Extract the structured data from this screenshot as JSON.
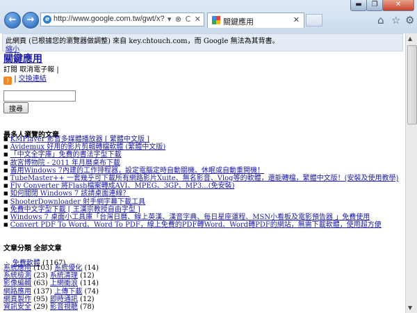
{
  "browser": {
    "url": "http://www.google.com.tw/gwt/x?u=",
    "addr_tools": "▾ ⊗ C ✕",
    "tab_title": "關鍵應用",
    "tab_close": "✕",
    "back_glyph": "←",
    "forward_glyph": "→",
    "home_glyph": "⌂",
    "star_glyph": "☆",
    "gear_glyph": "⚙",
    "min_glyph": "▬",
    "max_glyph": "❐",
    "close_glyph": "✕",
    "colors": {
      "chrome": "#cbdcef",
      "accent": "#1f5fb5",
      "close": "#c7432b"
    }
  },
  "notice": {
    "text": "此網頁 (已根據您的瀏覽器做調整) 來自 key.chtouch.com，而 Google 無法為其背書。",
    "link": "縮小"
  },
  "page": {
    "title": "關鍵應用",
    "subscribe": "訂閱",
    "unsubscribe": "取消電子報",
    "separator": "|",
    "rss_glyph": ")",
    "exchange_link": "交換連結",
    "search_value": "",
    "search_button": "搜尋"
  },
  "popular": {
    "heading": "最多人瀏覽的文章",
    "items": [
      "KMPlayer 影音多媒體播放器 [ 繁體中文版 ]",
      "Avidemux 好用的影片剪輯轉檔軟體 (繁體中文版)",
      "「中文全字庫」免費的書法字型下載",
      "故宮博物院 - 2011 年月曆桌布下載",
      "善用Windows 7內建的工作排程器，設定電腦定時自動關機、休眠或自動重開機！",
      "TubeMaster++ 一套幾乎可下載所有網路影片Xuite、無名影音、Vlog等的軟體，還能轉檔，繁體中文版！(安裝及使用教學)",
      "Fly Converter 將Flash檔案轉成AVI、MPEG、3GP、MP3...(免安裝)",
      "如何關閉 Windows 7 該請桌面連線？",
      "ShooterDownloader 射手網字幕下載工具",
      "免費中文字型下載 [ 王漢宗教授自由字型 ]",
      "Windows 7 桌面小工具庫「台灣日曆、線上英漢、漢音字典、每日星座運程、MSN小看板及電影預告器 」免費使用",
      "Convert PDF To Word、Word To PDF，線上免費的PDF轉Word、Word轉PDF的網站，無需下載軟體，使用超方便"
    ]
  },
  "categories": {
    "heading": "文章分類 全部文章",
    "lead_marker": ".:.",
    "lead_label": "免費軟體",
    "lead_count": "(1167)",
    "rows": [
      {
        "a": "系統應用",
        "ac": "(103)",
        "b": "系統優化",
        "bc": "(14)"
      },
      {
        "a": "系統檢測",
        "ac": "(23)",
        "b": "系統清理",
        "bc": "(12)"
      },
      {
        "a": "影像編輯",
        "ac": "(63)",
        "b": "上網衝浪",
        "bc": "(114)"
      },
      {
        "a": "網路應用",
        "ac": "(137)",
        "b": "上傳下載",
        "bc": "(74)"
      },
      {
        "a": "網頁製作",
        "ac": "(95)",
        "b": "即時通訊",
        "bc": "(12)"
      },
      {
        "a": "資訊安全",
        "ac": "(29)",
        "b": "影音視聽",
        "bc": "(78)"
      }
    ]
  }
}
